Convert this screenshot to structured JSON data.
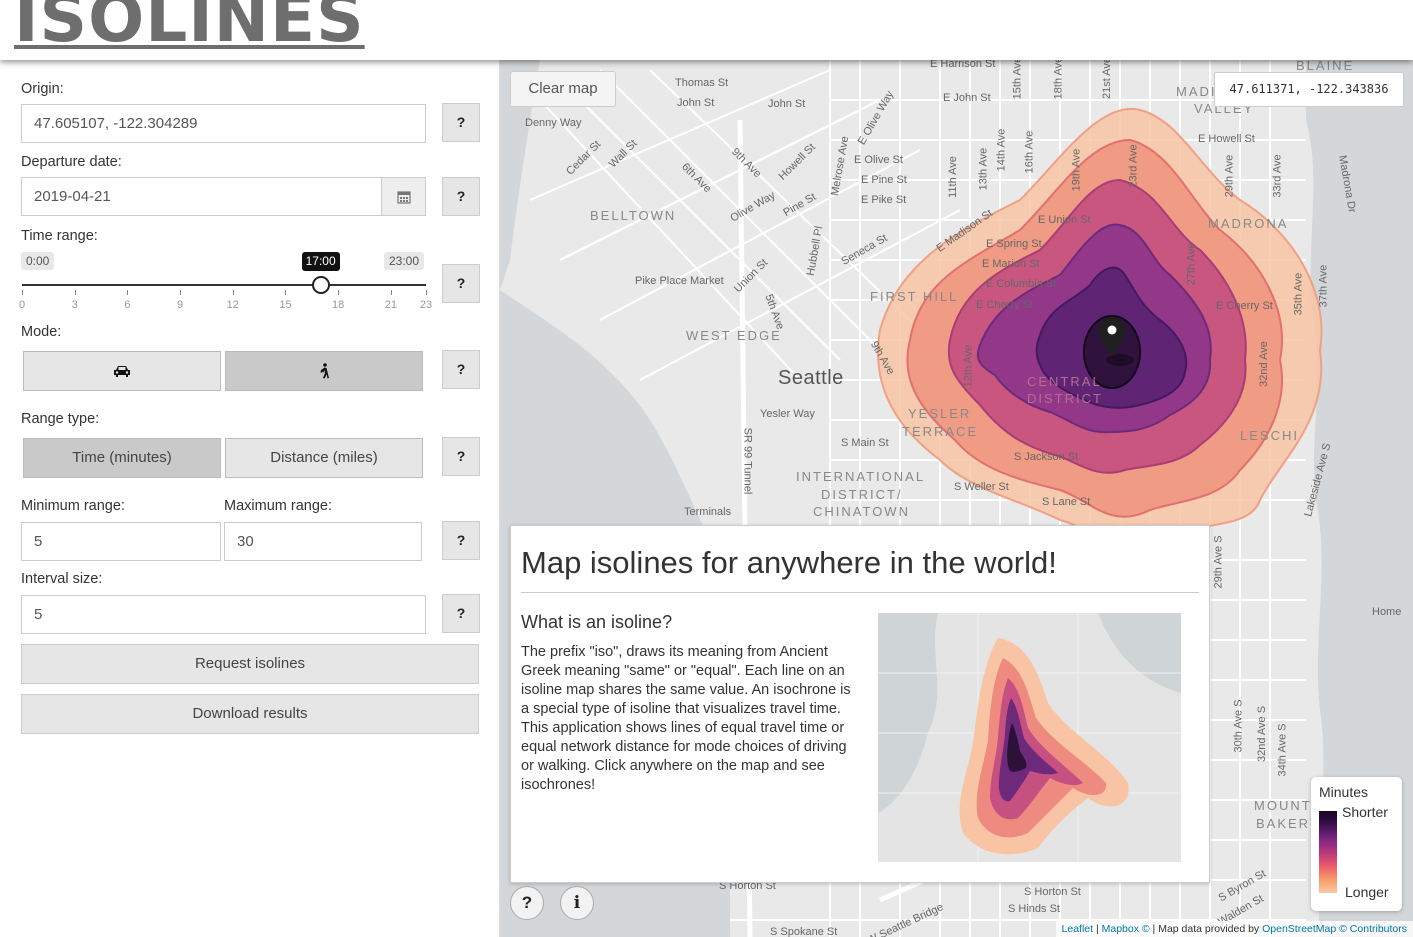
{
  "header": {
    "title": "ISOLINES"
  },
  "sidebar": {
    "origin_label": "Origin:",
    "origin_value": "47.605107, -122.304289",
    "departure_label": "Departure date:",
    "departure_value": "2019-04-21",
    "time_range_label": "Time range:",
    "slider": {
      "min_label": "0:00",
      "max_label": "23:00",
      "value_label": "17:00",
      "value": 17,
      "min": 0,
      "max": 23,
      "ticks": [
        "0",
        "3",
        "6",
        "9",
        "12",
        "15",
        "18",
        "21",
        "23"
      ]
    },
    "mode_label": "Mode:",
    "modes": [
      {
        "name": "driving",
        "icon": "car-icon",
        "active": false
      },
      {
        "name": "walking",
        "icon": "walking-person-icon",
        "active": true
      }
    ],
    "range_type_label": "Range type:",
    "range_types": [
      {
        "label": "Time (minutes)",
        "active": true
      },
      {
        "label": "Distance (miles)",
        "active": false
      }
    ],
    "min_range_label": "Minimum range:",
    "min_range_value": "5",
    "max_range_label": "Maximum range:",
    "max_range_value": "30",
    "interval_label": "Interval size:",
    "interval_value": "5",
    "help_label": "?",
    "request_label": "Request isolines",
    "download_label": "Download results"
  },
  "map": {
    "clear_label": "Clear map",
    "coordinates": "47.611371, -122.343836",
    "city_label": "Seattle",
    "district_labels": [
      "BELLTOWN",
      "FIRST HILL",
      "WEST EDGE",
      "YESLER",
      "TERRACE",
      "INTERNATIONAL",
      "DISTRICT/",
      "CHINATOWN",
      "MADRONA",
      "LESCHI",
      "MOUNT",
      "BAKER",
      "CENTRAL",
      "DISTRICT",
      "MADISON",
      "VALLEY",
      "BLAINE"
    ],
    "street_labels": [
      "Thomas St",
      "John St",
      "John St",
      "Denny Way",
      "Cedar St",
      "Wall St",
      "6th Ave",
      "9th Ave",
      "Howell St",
      "Olive Way",
      "Pine St",
      "E Olive St",
      "E Pine St",
      "E Pike St",
      "E Olive Way",
      "E John St",
      "E Harrison St",
      "Melrose Ave",
      "Pike Place Market",
      "Union St",
      "5th Ave",
      "Hubbell Pl",
      "Seneca St",
      "9th Ave",
      "Yesler Way",
      "S Main St",
      "SR 99 Tunnel",
      "E Madison St",
      "E Union St",
      "E Spring St",
      "E Marion St",
      "E Columbia St",
      "E Cherry St",
      "E Cherry St",
      "12th Ave",
      "23rd Ave",
      "19th Ave",
      "E Howell St",
      "29th Ave",
      "33rd Ave",
      "Madrona Dr",
      "35th Ave",
      "37th Ave",
      "32nd Ave",
      "S Jackson St",
      "S Weller St",
      "S Lane St",
      "Lakeside Ave S",
      "29th Ave S",
      "30th Ave S",
      "32nd Ave S",
      "34th Ave S",
      "S Horton St",
      "S Horton St",
      "S Hinds St",
      "S Byron St",
      "S Walden St",
      "S Spokane St",
      "W Seattle Bridge",
      "Terminals",
      "Home",
      "14th Ave",
      "13th Ave",
      "11th Ave",
      "16th Ave",
      "18th Ave",
      "21st Ave",
      "15th Ave",
      "27th Ave"
    ],
    "info": {
      "title": "Map isolines for anywhere in the world!",
      "subtitle": "What is an isoline?",
      "body": "The prefix \"iso\", draws its meaning from Ancient Greek meaning \"same\" or \"equal\". Each line on an isoline map shares the same value. An isochrone is a special type of isoline that visualizes travel time. This application shows lines of equal travel time or equal network distance for mode choices of driving or walking. Click anywhere on the map and see isochrones!"
    },
    "help_button": "?",
    "info_button": "i",
    "legend": {
      "title": "Minutes",
      "top": "Shorter",
      "bottom": "Longer"
    },
    "attribution": {
      "leaflet": "Leaflet",
      "mapbox": "Mapbox ©",
      "sep": " | Map data provided by ",
      "osm": "OpenStreetMap © Contributors"
    },
    "colors": {
      "iso5": "#2c1238",
      "iso10": "#6a2b7a",
      "iso15": "#9a3c88",
      "iso20": "#c9557f",
      "iso25": "#ee8a80",
      "iso30": "#f7b894",
      "water": "#d4d7d9"
    }
  }
}
